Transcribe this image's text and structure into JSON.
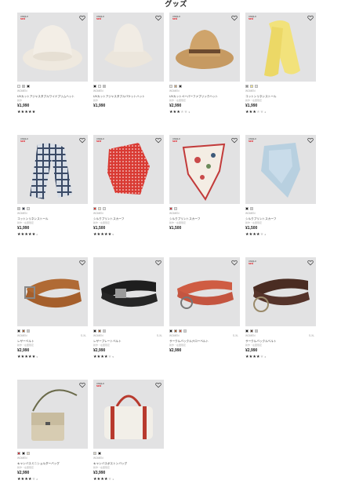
{
  "section_title": "グッズ",
  "products": [
    {
      "badge_top": "UNIQLO",
      "badge_bottom": "NEW",
      "colors": [
        "#efefef",
        "#bfbfbf",
        "#2a2a2a"
      ],
      "gender": "WOMEN",
      "size": "",
      "name": "UVカットアジャスタブルワイドブリムハット",
      "sub": "新作",
      "price": "¥1,990",
      "rating": 5,
      "reviews": "",
      "shape": "bucket-wide",
      "wide_badge": false
    },
    {
      "badge_top": "UNIQLO",
      "badge_bottom": "NEW",
      "colors": [
        "#1a1a1a",
        "#efefef",
        "#bdbdbd"
      ],
      "gender": "WOMEN",
      "size": "",
      "name": "UVカットアジャスタブルバケットハット",
      "sub": "新作",
      "price": "¥1,990",
      "rating": 0,
      "reviews": "",
      "shape": "bucket",
      "wide_badge": false
    },
    {
      "badge_top": "UNIQLO",
      "badge_bottom": "NEW",
      "colors": [
        "#e9e6df",
        "#c6a47a",
        "#2f2f2f"
      ],
      "gender": "WOMEN",
      "size": "",
      "name": "UVカットペーパーファブリックハット",
      "sub": "新作・在庫限定",
      "price": "¥2,990",
      "rating": 3,
      "reviews": "3",
      "shape": "fedora",
      "wide_badge": false
    },
    {
      "badge_top": "UNIQLO",
      "badge_bottom": "NEW",
      "colors": [
        "#8e8e8e",
        "#efe38f",
        "#dcdcdc"
      ],
      "gender": "WOMEN",
      "size": "",
      "name": "コットンリネンストール",
      "sub": "新作・在庫限定",
      "price": "¥1,990",
      "rating": 3,
      "reviews": "2",
      "shape": "scarf-yellow",
      "wide_badge": false
    },
    {
      "badge_top": "UNIQLO",
      "badge_bottom": "NEW",
      "colors": [
        "#c9c9c9",
        "#3b4252",
        "#e6e6e6"
      ],
      "gender": "WOMEN",
      "size": "",
      "name": "コットンリネンストール",
      "sub": "新作・在庫限定",
      "price": "¥1,990",
      "rating": 5,
      "reviews": "2",
      "shape": "scarf-plaid",
      "wide_badge": false
    },
    {
      "badge_top": "UNIQLO",
      "badge_bottom": "NEW",
      "colors": [
        "#d9362f",
        "#efe0c0",
        "#e8e8e8"
      ],
      "gender": "WOMEN",
      "size": "",
      "name": "シルクプリントスカーフ",
      "sub": "新作・在庫限定",
      "price": "¥1,500",
      "rating": 5,
      "reviews": "5",
      "shape": "scarf-red",
      "wide_badge": false
    },
    {
      "badge_top": "UNIQLO",
      "badge_bottom": "NEW",
      "colors": [
        "#c8343a",
        "#e0e0e0"
      ],
      "gender": "WOMEN",
      "size": "",
      "name": "シルクプリントスカーフ",
      "sub": "新作・在庫限定",
      "price": "¥1,500",
      "rating": 0,
      "reviews": "",
      "shape": "scarf-floral",
      "wide_badge": false
    },
    {
      "badge_top": "UNIQLO",
      "badge_bottom": "NEW",
      "colors": [
        "#222222",
        "#cfcfcf"
      ],
      "gender": "WOMEN",
      "size": "",
      "name": "シルクプリントスカーフ",
      "sub": "新作・在庫限定",
      "price": "¥1,500",
      "rating": 4,
      "reviews": "4",
      "shape": "scarf-blue",
      "wide_badge": false
    },
    {
      "badge_top": "",
      "badge_bottom": "",
      "colors": [
        "#2b2b2b",
        "#9b5a2c",
        "#c9c9c9"
      ],
      "gender": "WOMEN",
      "size": "S-XL",
      "name": "レザーベルト",
      "sub": "新作・在庫限定",
      "price": "¥2,990",
      "rating": 5,
      "reviews": "3",
      "shape": "belt-tan",
      "wide_badge": false
    },
    {
      "badge_top": "",
      "badge_bottom": "",
      "colors": [
        "#1b1b1b",
        "#9b5a2c",
        "#c9c9c9"
      ],
      "gender": "WOMEN",
      "size": "S-XL",
      "name": "レザープレートベルト",
      "sub": "新作・在庫限定",
      "price": "¥2,990",
      "rating": 4,
      "reviews": "5",
      "shape": "belt-black",
      "wide_badge": false
    },
    {
      "badge_top": "",
      "badge_bottom": "",
      "colors": [
        "#1f1f1f",
        "#9b5a2c",
        "#c8563e",
        "#d4d4d4"
      ],
      "gender": "WOMEN",
      "size": "S-XL",
      "name": "サークルバックルナローベルト",
      "sub": "新作・在庫限定",
      "price": "¥2,990",
      "rating": 0,
      "reviews": "",
      "shape": "belt-red",
      "wide_badge": false
    },
    {
      "badge_top": "UNIQLO",
      "badge_bottom": "NEW",
      "colors": [
        "#1c1c1c",
        "#5b3a2b",
        "#c9c9c9"
      ],
      "gender": "WOMEN",
      "size": "S-XL",
      "name": "サークルバックルベルト",
      "sub": "新作・在庫限定",
      "price": "¥2,990",
      "rating": 4,
      "reviews": "4",
      "shape": "belt-brown",
      "wide_badge": false
    },
    {
      "badge_top": "",
      "badge_bottom": "",
      "colors": [
        "#c8343a",
        "#222222",
        "#e3d8bf"
      ],
      "gender": "WOMEN",
      "size": "",
      "name": "キャンバスミニショルダーバッグ",
      "sub": "新作・在庫限定",
      "price": "¥2,990",
      "rating": 4,
      "reviews": "2",
      "shape": "bag-shoulder",
      "wide_badge": false
    },
    {
      "badge_top": "UNIQLO",
      "badge_bottom": "NEW",
      "colors": [
        "#d9d4c6",
        "#1b1b1b"
      ],
      "gender": "WOMEN",
      "size": "",
      "name": "キャンバスボストンバッグ",
      "sub": "新作・在庫限定",
      "price": "¥3,990",
      "rating": 4,
      "reviews": "1",
      "shape": "bag-boston",
      "wide_badge": false
    }
  ]
}
